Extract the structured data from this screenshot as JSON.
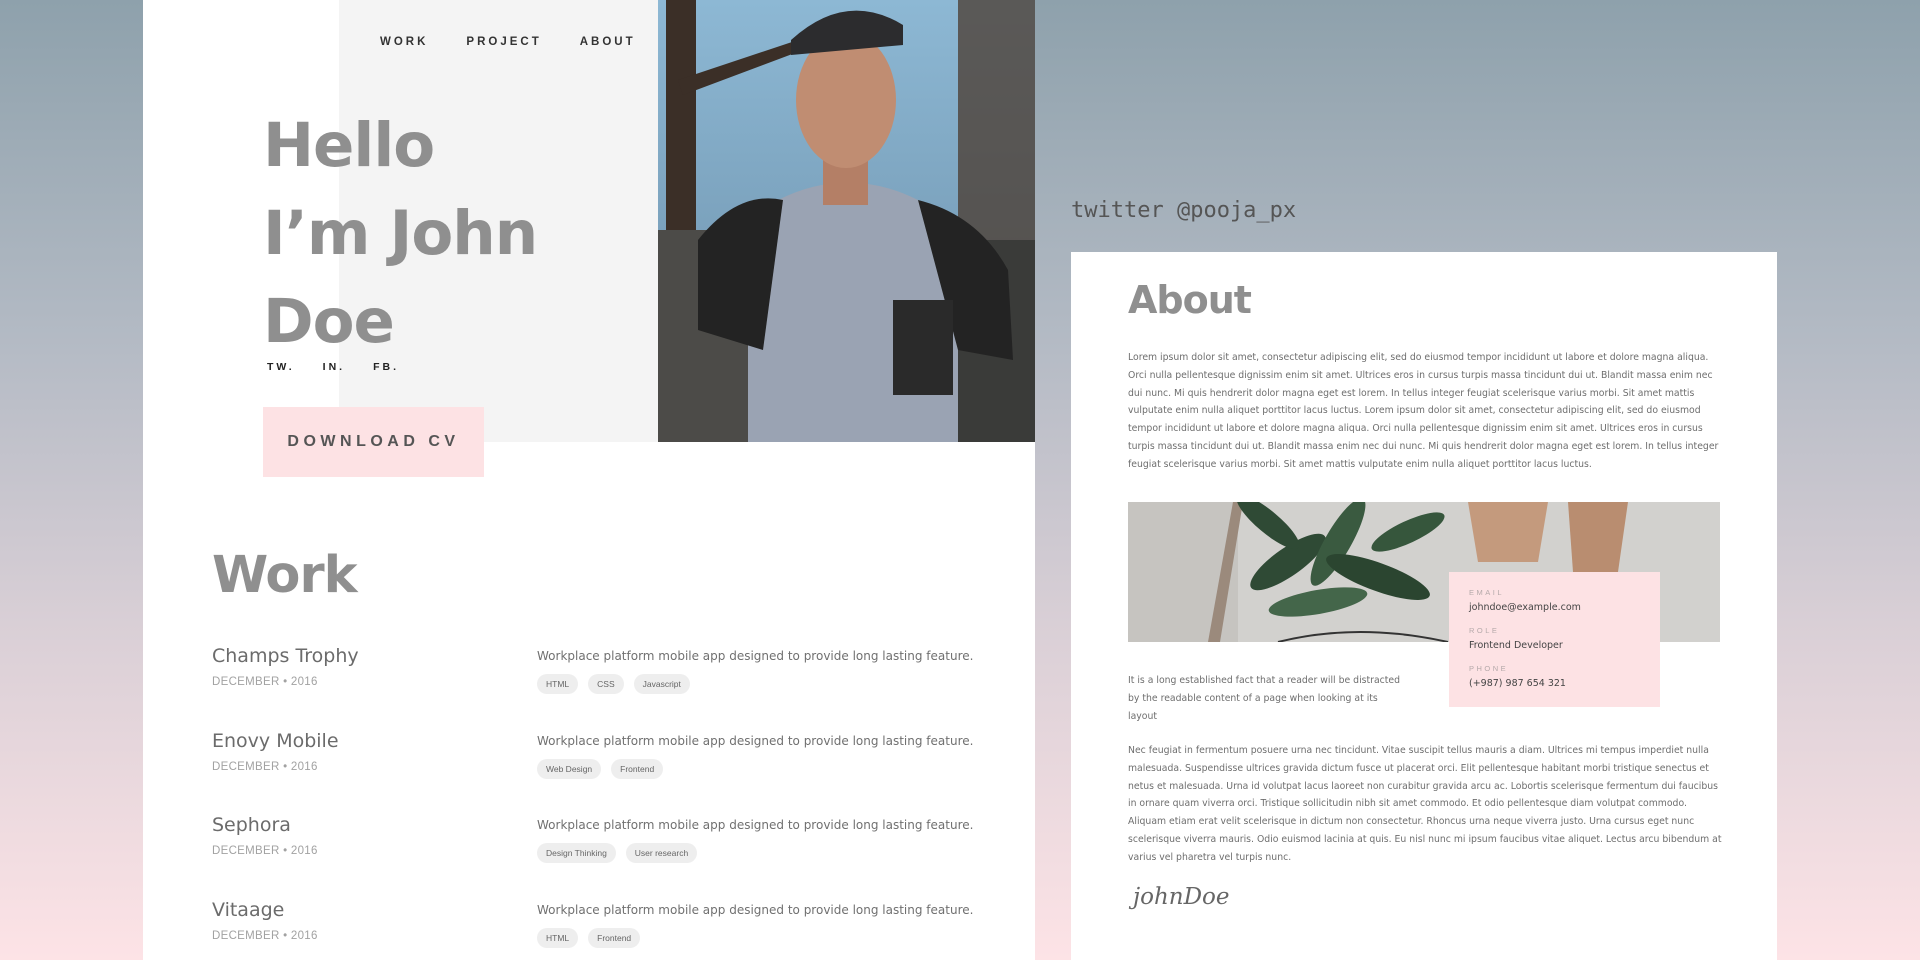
{
  "nav": {
    "items": [
      "WORK",
      "PROJECT",
      "ABOUT"
    ]
  },
  "hero": {
    "title_lines": [
      "Hello",
      "I’m John",
      "Doe"
    ],
    "socials": [
      "TW.",
      "IN.",
      "FB."
    ],
    "cv_button": "DOWNLOAD CV"
  },
  "work": {
    "title": "Work",
    "items": [
      {
        "name": "Champs Trophy",
        "date": "DECEMBER • 2016",
        "description": "Workplace platform mobile app designed to provide long lasting feature.",
        "tags": [
          "HTML",
          "CSS",
          "Javascript"
        ]
      },
      {
        "name": "Enovy Mobile",
        "date": "DECEMBER • 2016",
        "description": "Workplace platform mobile app designed to provide long lasting feature.",
        "tags": [
          "Web Design",
          "Frontend"
        ]
      },
      {
        "name": "Sephora",
        "date": "DECEMBER • 2016",
        "description": "Workplace platform mobile app designed to provide long lasting feature.",
        "tags": [
          "Design Thinking",
          "User research"
        ]
      },
      {
        "name": "Vitaage",
        "date": "DECEMBER • 2016",
        "description": "Workplace platform mobile app designed to provide long lasting feature.",
        "tags": [
          "HTML",
          "Frontend"
        ]
      }
    ]
  },
  "twitter_handle": "twitter @pooja_px",
  "about": {
    "title": "About",
    "paragraph": "Lorem ipsum dolor sit amet, consectetur adipiscing elit, sed do eiusmod tempor incididunt ut labore et dolore magna aliqua. Orci nulla pellentesque dignissim enim sit amet. Ultrices eros in cursus turpis massa tincidunt dui ut. Blandit massa enim nec dui nunc. Mi quis hendrerit dolor magna eget est lorem. In tellus integer feugiat scelerisque varius morbi. Sit amet mattis vulputate enim nulla aliquet porttitor lacus luctus. Lorem ipsum dolor sit amet, consectetur adipiscing elit, sed do eiusmod tempor incididunt ut labore et dolore magna aliqua. Orci nulla pellentesque dignissim enim sit amet. Ultrices eros in cursus turpis massa tincidunt dui ut. Blandit massa enim nec dui nunc. Mi quis hendrerit dolor magna eget est lorem. In tellus integer feugiat scelerisque varius morbi. Sit amet mattis vulputate enim nulla aliquet porttitor lacus luctus.",
    "contact": {
      "email_label": "EMAIL",
      "email": "johndoe@example.com",
      "role_label": "ROLE",
      "role": "Frontend Developer",
      "phone_label": "PHONE",
      "phone": "(+987) 987 654 321"
    },
    "short_text": "It is a long established fact that a reader will be distracted by the readable content of a page when looking at its layout",
    "long_text": "Nec feugiat in fermentum posuere urna nec tincidunt. Vitae suscipit tellus mauris a diam. Ultrices mi tempus imperdiet nulla malesuada. Suspendisse ultrices gravida dictum fusce ut placerat orci. Elit pellentesque habitant morbi tristique senectus et netus et malesuada. Urna id volutpat lacus laoreet non curabitur gravida arcu ac. Lobortis scelerisque fermentum dui faucibus in ornare quam viverra orci. Tristique sollicitudin nibh sit amet commodo. Et odio pellentesque diam volutpat commodo. Aliquam etiam erat velit scelerisque in dictum non consectetur. Rhoncus urna neque viverra justo. Urna cursus eget nunc scelerisque viverra mauris. Odio euismod lacinia at quis. Eu nisl nunc mi ipsum faucibus vitae aliquet.  Lectus arcu bibendum at varius vel pharetra vel turpis nunc.",
    "signature": "johnDoe"
  }
}
